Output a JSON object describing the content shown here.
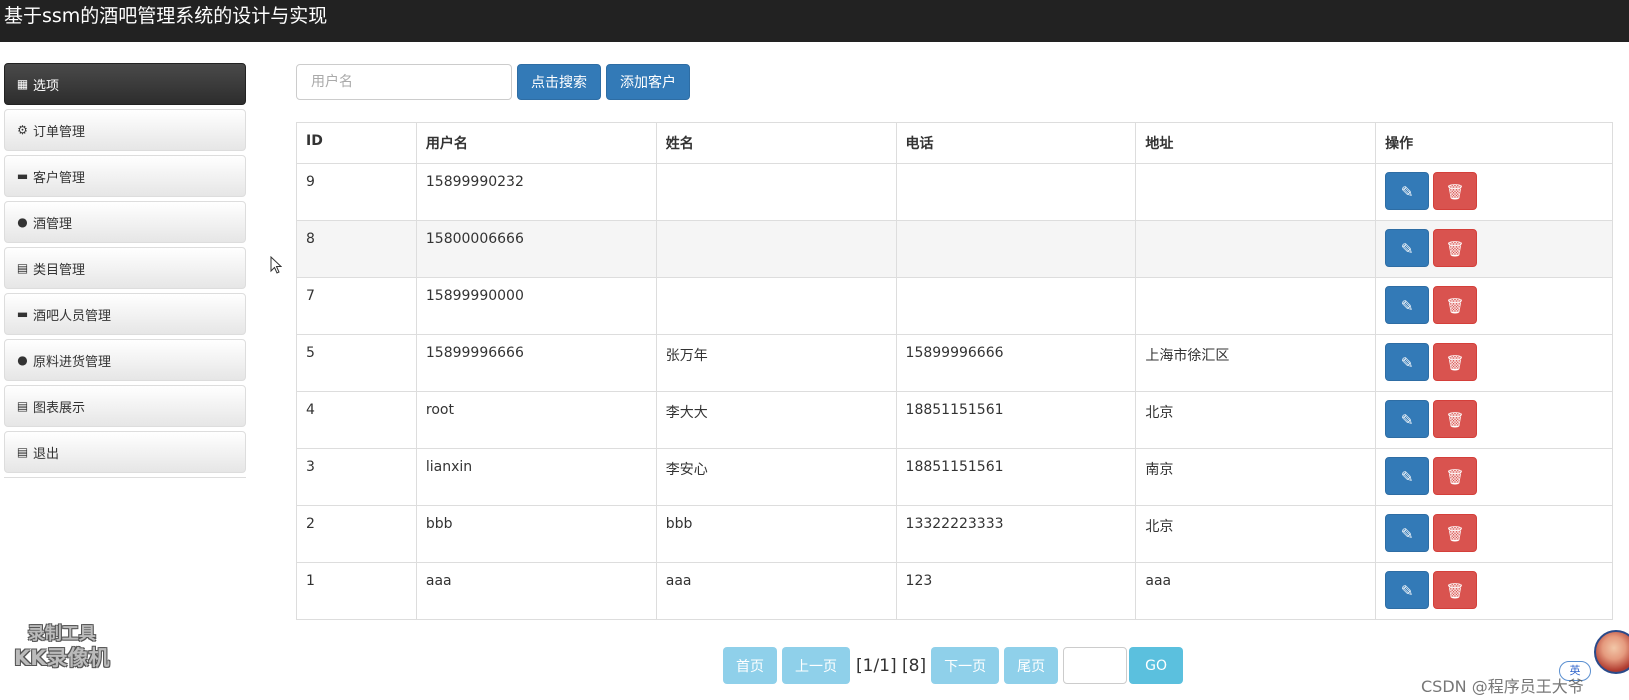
{
  "header": {
    "title": "基于ssm的酒吧管理系统的设计与实现"
  },
  "sidebar": {
    "items": [
      {
        "label": "选项",
        "icon": "grid-icon",
        "active": true
      },
      {
        "label": "订单管理",
        "icon": "gear-icon"
      },
      {
        "label": "客户管理",
        "icon": "credit-card-icon"
      },
      {
        "label": "酒管理",
        "icon": "globe-icon"
      },
      {
        "label": "类目管理",
        "icon": "calendar-icon"
      },
      {
        "label": "酒吧人员管理",
        "icon": "credit-card-icon"
      },
      {
        "label": "原料进货管理",
        "icon": "globe-icon"
      },
      {
        "label": "图表展示",
        "icon": "calendar-icon"
      },
      {
        "label": "退出",
        "icon": "calendar-icon"
      }
    ]
  },
  "search": {
    "placeholder": "用户名",
    "value": "",
    "search_label": "点击搜索",
    "add_label": "添加客户"
  },
  "table": {
    "headers": {
      "id": "ID",
      "username": "用户名",
      "name": "姓名",
      "phone": "电话",
      "address": "地址",
      "ops": "操作"
    },
    "rows": [
      {
        "id": "9",
        "username": "15899990232",
        "name": "",
        "phone": "",
        "address": ""
      },
      {
        "id": "8",
        "username": "15800006666",
        "name": "",
        "phone": "",
        "address": ""
      },
      {
        "id": "7",
        "username": "15899990000",
        "name": "",
        "phone": "",
        "address": ""
      },
      {
        "id": "5",
        "username": "15899996666",
        "name": "张万年",
        "phone": "15899996666",
        "address": "上海市徐汇区"
      },
      {
        "id": "4",
        "username": "root",
        "name": "李大大",
        "phone": "18851151561",
        "address": "北京"
      },
      {
        "id": "3",
        "username": "lianxin",
        "name": "李安心",
        "phone": "18851151561",
        "address": "南京"
      },
      {
        "id": "2",
        "username": "bbb",
        "name": "bbb",
        "phone": "13322223333",
        "address": "北京"
      },
      {
        "id": "1",
        "username": "aaa",
        "name": "aaa",
        "phone": "123",
        "address": "aaa"
      }
    ]
  },
  "pagination": {
    "first": "首页",
    "prev": "上一页",
    "info": "[1/1] [8]",
    "next": "下一页",
    "last": "尾页",
    "go": "GO"
  },
  "overlay": {
    "watermark_line1": "录制工具",
    "watermark_line2": "KK录像机",
    "credit": "CSDN @程序员王大爷",
    "ime": "英"
  },
  "colors": {
    "primary": "#337ab7",
    "danger": "#d9534f",
    "info": "#5bc0de",
    "header_bg": "#222222"
  }
}
